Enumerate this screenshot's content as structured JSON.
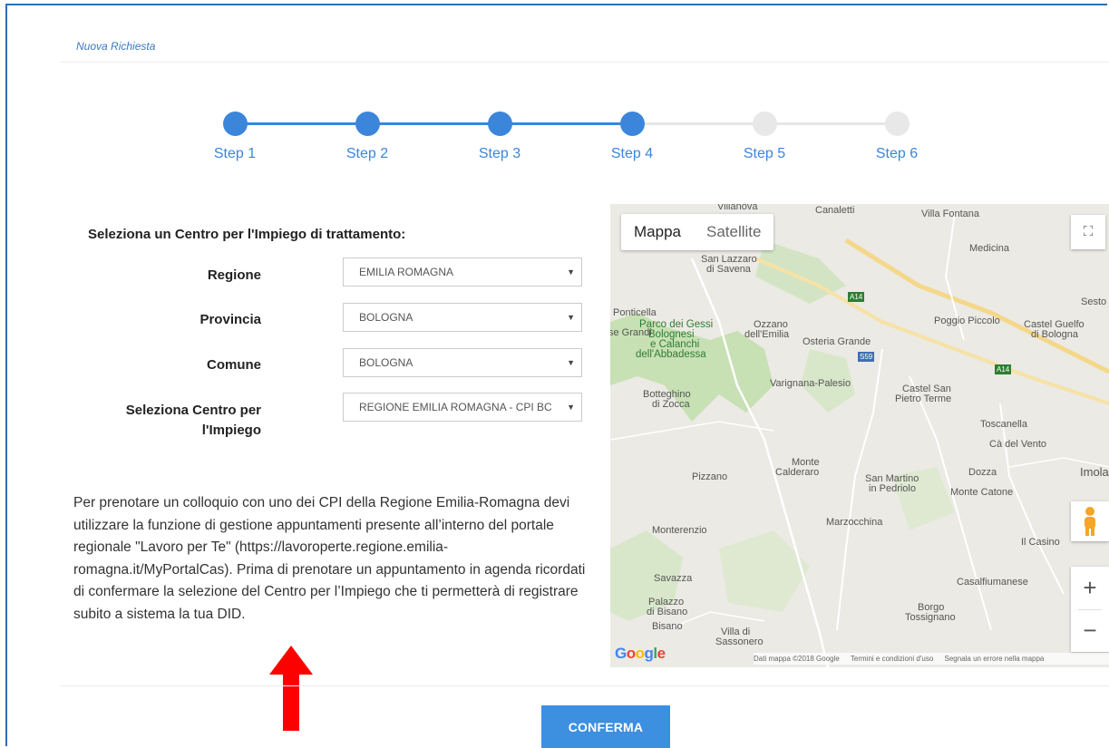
{
  "page": {
    "title": "Nuova Richiesta"
  },
  "stepper": {
    "steps": [
      {
        "label": "Step 1",
        "active": true
      },
      {
        "label": "Step 2",
        "active": true
      },
      {
        "label": "Step 3",
        "active": true
      },
      {
        "label": "Step 4",
        "active": true
      },
      {
        "label": "Step 5",
        "active": false
      },
      {
        "label": "Step 6",
        "active": false
      }
    ]
  },
  "form": {
    "heading": "Seleziona un Centro per l'Impiego di trattamento:",
    "regione": {
      "label": "Regione",
      "value": "EMILIA ROMAGNA"
    },
    "provincia": {
      "label": "Provincia",
      "value": "BOLOGNA"
    },
    "comune": {
      "label": "Comune",
      "value": "BOLOGNA"
    },
    "centro": {
      "label_line1": "Seleziona Centro per",
      "label_line2": "l'Impiego",
      "value": "REGIONE EMILIA ROMAGNA - CPI BC"
    }
  },
  "info_text": "Per prenotare un colloquio con uno dei CPI della Regione Emilia-Romagna devi utilizzare la funzione di gestione appuntamenti presente all’interno del portale regionale \"Lavoro per Te\" (https://lavoroperte.regione.emilia-romagna.it/MyPortalCas). Prima di prenotare un appuntamento in agenda ricordati di confermare la selezione del Centro per l’Impiego che ti permetterà di registrare subito a sistema la tua DID.",
  "map": {
    "toggle_map": "Mappa",
    "toggle_satellite": "Satellite",
    "zoom_in": "+",
    "zoom_out": "−",
    "google": "Google",
    "attribution": [
      "Dati mappa ©2018 Google",
      "Termini e condizioni d'uso",
      "Segnala un errore nella mappa"
    ],
    "places": {
      "p1": "Villanova",
      "p2": "Canaletti",
      "p3": "Villa Fontana",
      "p4": "Medicina",
      "p5": "Sesto",
      "p6": "San Lazzaro",
      "p7": "di Savena",
      "p8": "Ponticella",
      "p9": "se Grandi",
      "p10": "Ozzano",
      "p11": "dell'Emilia",
      "p12": "Poggio Piccolo",
      "p13": "Castel Guelfo",
      "p14": "di Bologna",
      "p15": "Parco dei Gessi",
      "p16": "Bolognesi",
      "p17": "e Calanchi",
      "p18": "dell'Abbadessa",
      "p19": "Osteria Grande",
      "p20": "Varignana-Palesio",
      "p21": "Castel San",
      "p22": "Pietro Terme",
      "p23": "Botteghino",
      "p24": "di Zocca",
      "p25": "Toscanella",
      "p26": "Cà del Vento",
      "p27": "Monte",
      "p28": "Calderaro",
      "p29": "Pizzano",
      "p30": "San Martino",
      "p31": "in Pedriolo",
      "p32": "Dozza",
      "p33": "Monte Catone",
      "p34": "Imola",
      "p35": "Marzocchina",
      "p36": "Monterenzio",
      "p37": "Il Casino",
      "p38": "Savazza",
      "p39": "Casalfiumanese",
      "p40": "Palazzo",
      "p41": "di Bisano",
      "p42": "Borgo",
      "p43": "Tossignano",
      "p44": "Bisano",
      "p45": "Villa di",
      "p46": "Sassonero",
      "p47": "A14",
      "p48": "S59",
      "p49": "A14"
    }
  },
  "actions": {
    "confirm": "CONFERMA"
  },
  "colors": {
    "accent": "#3b86db",
    "button": "#3d8fe0",
    "arrow": "#ff0000"
  }
}
